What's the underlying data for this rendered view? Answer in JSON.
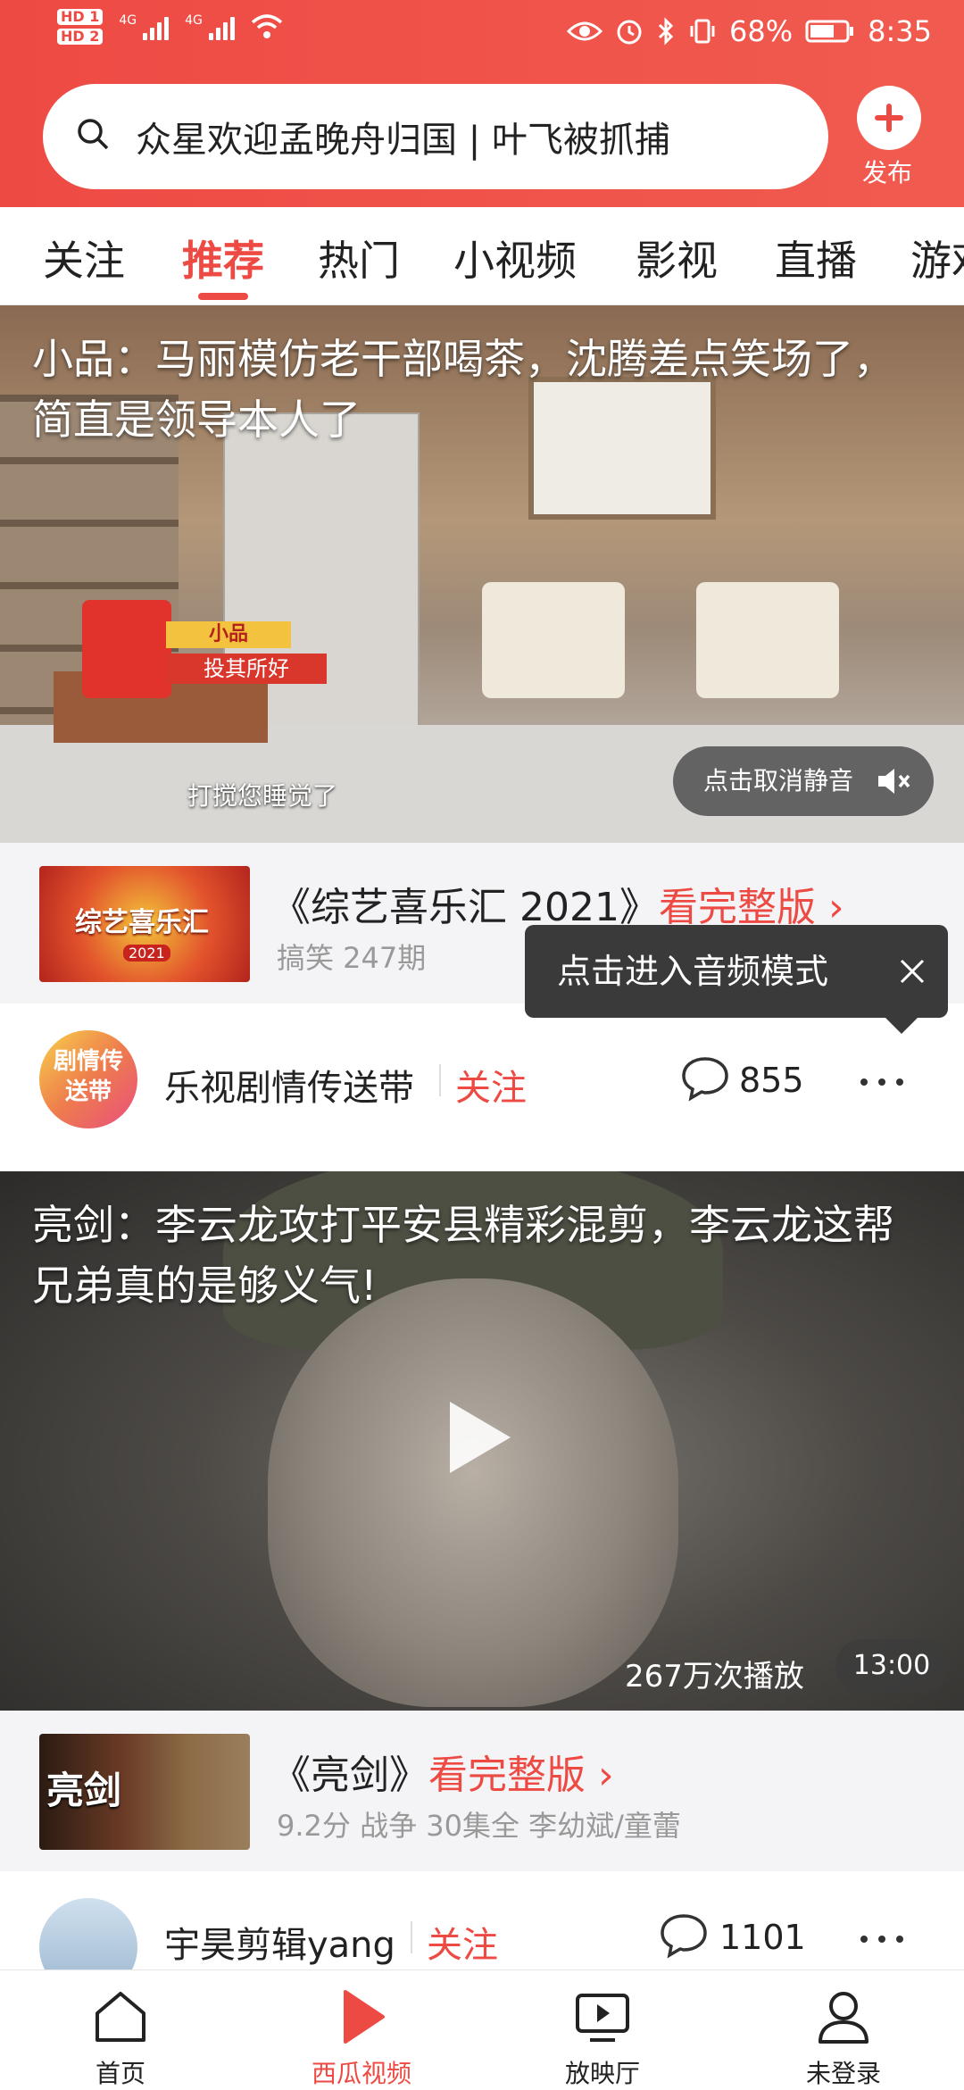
{
  "status_bar": {
    "sim1": "HD 1",
    "sim2": "HD 2",
    "net1": "4G",
    "net2": "4G",
    "battery": "68%",
    "time": "8:35"
  },
  "search": {
    "query": "众星欢迎孟晚舟归国 | 叶飞被抓捕",
    "publish_label": "发布"
  },
  "tabs": [
    {
      "label": "关注",
      "active": false
    },
    {
      "label": "推荐",
      "active": true
    },
    {
      "label": "热门",
      "active": false
    },
    {
      "label": "小视频",
      "active": false
    },
    {
      "label": "影视",
      "active": false
    },
    {
      "label": "直播",
      "active": false
    },
    {
      "label": "游戏",
      "active": false
    }
  ],
  "feed": [
    {
      "video": {
        "title": "小品：马丽模仿老干部喝茶，沈腾差点笑场了，简直是领导本人了",
        "caption_top": "小品",
        "caption_bottom": "投其所好",
        "subtitle": "打搅您睡觉了",
        "mute_label": "点击取消静音"
      },
      "card": {
        "title": "《综艺喜乐汇 2021》",
        "more": "看完整版",
        "sub": "搞笑 247期",
        "thumb_text": "综艺喜乐汇",
        "thumb_year": "2021"
      },
      "tooltip": "点击进入音频模式",
      "author": {
        "name": "乐视剧情传送带",
        "avatar_text": "剧情传送带",
        "follow": "关注",
        "comments": "855"
      }
    },
    {
      "video": {
        "title": "亮剑：李云龙攻打平安县精彩混剪，李云龙这帮兄弟真的是够义气!",
        "views": "267万次播放",
        "duration": "13:00"
      },
      "card": {
        "title": "《亮剑》",
        "more": "看完整版",
        "sub": "9.2分 战争 30集全 李幼斌/童蕾",
        "thumb_text": "亮剑"
      },
      "author": {
        "name": "宇昊剪辑yang",
        "follow": "关注",
        "comments": "1101"
      }
    }
  ],
  "bottom_nav": [
    {
      "label": "首页",
      "icon": "home-icon",
      "active": false
    },
    {
      "label": "西瓜视频",
      "icon": "xigua-play-icon",
      "active": true
    },
    {
      "label": "放映厅",
      "icon": "screening-room-icon",
      "active": false
    },
    {
      "label": "未登录",
      "icon": "user-icon",
      "active": false
    }
  ],
  "colors": {
    "accent": "#ee4a44",
    "tooltip_bg": "#3a3a3a",
    "card_bg": "#f4f4f6"
  }
}
